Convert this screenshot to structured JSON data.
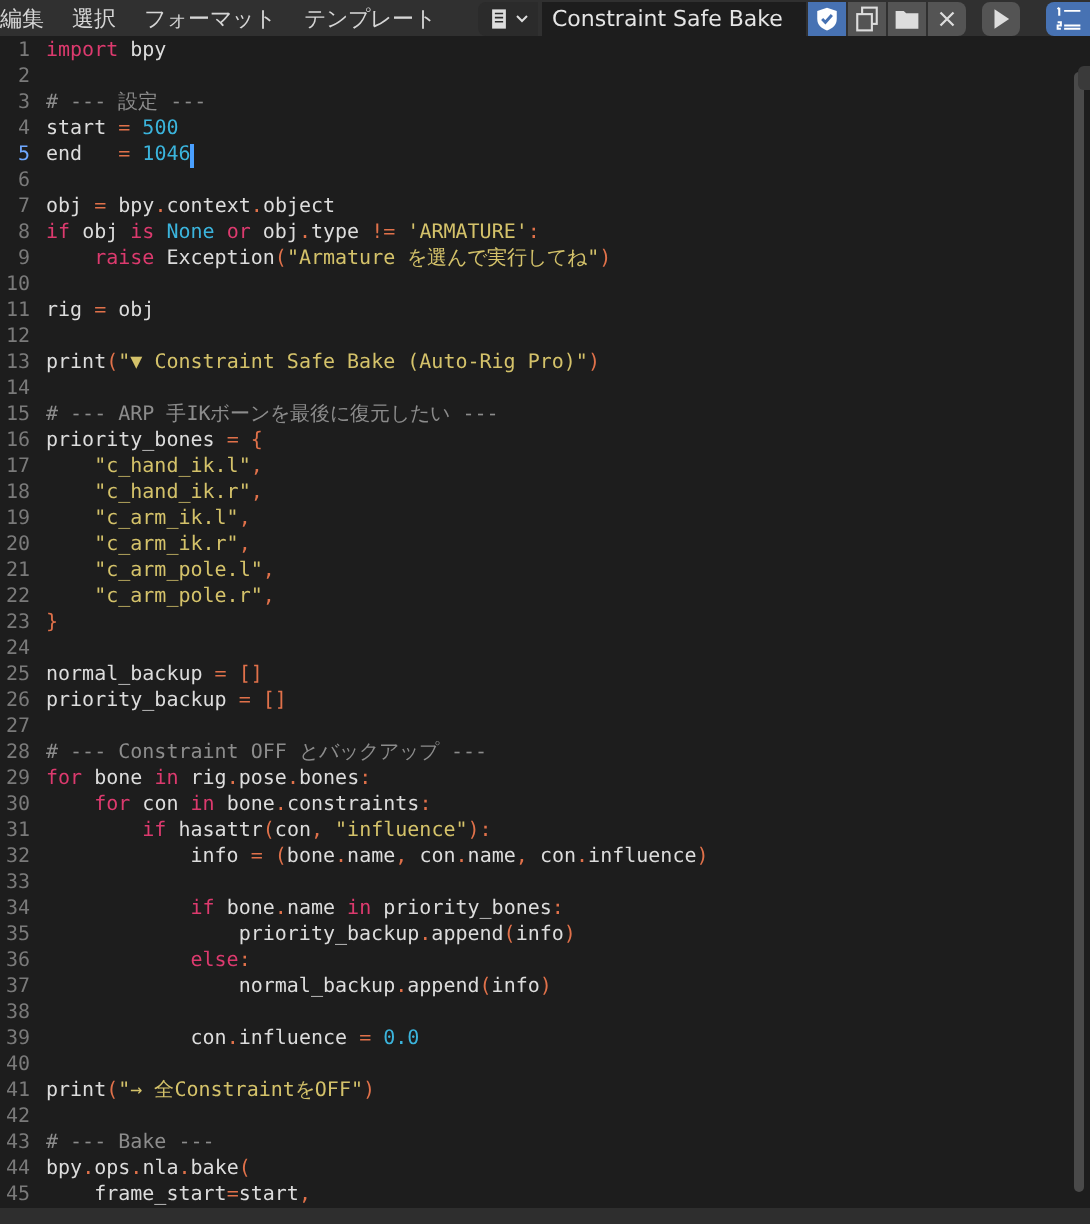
{
  "header": {
    "menus": [
      "編集",
      "選択",
      "フォーマット",
      "テンプレート"
    ],
    "text_name": "Constraint Safe Bake",
    "buttons": [
      {
        "kind": "register",
        "on": true
      },
      {
        "kind": "copy",
        "on": false
      },
      {
        "kind": "open",
        "on": false
      },
      {
        "kind": "unlink",
        "on": false
      }
    ],
    "line_numbers_toggle": {
      "on": true
    }
  },
  "editor": {
    "lines": [
      {
        "number": "1",
        "current": false,
        "tokens": [
          {
            "kind": "keyword",
            "text": "import"
          },
          {
            "kind": "plain",
            "text": " bpy"
          }
        ]
      },
      {
        "number": "2",
        "current": false
      },
      {
        "number": "3",
        "current": false,
        "tokens": [
          {
            "kind": "comment",
            "text": "# --- 設定 ---"
          }
        ]
      },
      {
        "number": "4",
        "current": false,
        "tokens": [
          {
            "kind": "plain",
            "text": "start "
          },
          {
            "kind": "op",
            "text": "="
          },
          {
            "kind": "number",
            "text": " 500"
          }
        ]
      },
      {
        "number": "5",
        "current": true,
        "tokens": [
          {
            "kind": "plain",
            "text": "end   "
          },
          {
            "kind": "op",
            "text": "="
          },
          {
            "kind": "number",
            "text": " 1046"
          }
        ]
      },
      {
        "number": "6",
        "current": false
      },
      {
        "number": "7",
        "current": false,
        "tokens": [
          {
            "kind": "plain",
            "text": "obj "
          },
          {
            "kind": "op",
            "text": "="
          },
          {
            "kind": "plain",
            "text": " bpy"
          },
          {
            "kind": "op",
            "text": "."
          },
          {
            "kind": "plain",
            "text": "context"
          },
          {
            "kind": "op",
            "text": "."
          },
          {
            "kind": "plain",
            "text": "object"
          }
        ]
      },
      {
        "number": "8",
        "current": false,
        "tokens": [
          {
            "kind": "keyword",
            "text": "if"
          },
          {
            "kind": "plain",
            "text": " obj "
          },
          {
            "kind": "keyword",
            "text": "is"
          },
          {
            "kind": "number",
            "text": " None"
          },
          {
            "kind": "keyword",
            "text": " or"
          },
          {
            "kind": "plain",
            "text": " obj"
          },
          {
            "kind": "op",
            "text": "."
          },
          {
            "kind": "plain",
            "text": "type "
          },
          {
            "kind": "op",
            "text": "!="
          },
          {
            "kind": "string",
            "text": " 'ARMATURE'"
          },
          {
            "kind": "op",
            "text": ":"
          }
        ]
      },
      {
        "number": "9",
        "current": false,
        "tokens": [
          {
            "kind": "keyword",
            "text": "    raise"
          },
          {
            "kind": "plain",
            "text": " Exception"
          },
          {
            "kind": "op",
            "text": "("
          },
          {
            "kind": "string",
            "text": "\"Armature を選んで実行してね\""
          },
          {
            "kind": "op",
            "text": ")"
          }
        ]
      },
      {
        "number": "10",
        "current": false
      },
      {
        "number": "11",
        "current": false,
        "tokens": [
          {
            "kind": "plain",
            "text": "rig "
          },
          {
            "kind": "op",
            "text": "="
          },
          {
            "kind": "plain",
            "text": " obj"
          }
        ]
      },
      {
        "number": "12",
        "current": false
      },
      {
        "number": "13",
        "current": false,
        "tokens": [
          {
            "kind": "plain",
            "text": "print"
          },
          {
            "kind": "op",
            "text": "("
          },
          {
            "kind": "string",
            "text": "\"▼ Constraint Safe Bake (Auto-Rig Pro)\""
          },
          {
            "kind": "op",
            "text": ")"
          }
        ]
      },
      {
        "number": "14",
        "current": false
      },
      {
        "number": "15",
        "current": false,
        "tokens": [
          {
            "kind": "comment",
            "text": "# --- ARP 手IKボーンを最後に復元したい ---"
          }
        ]
      },
      {
        "number": "16",
        "current": false,
        "tokens": [
          {
            "kind": "plain",
            "text": "priority_bones "
          },
          {
            "kind": "op",
            "text": "= {"
          }
        ]
      },
      {
        "number": "17",
        "current": false,
        "tokens": [
          {
            "kind": "string",
            "text": "    \"c_hand_ik.l\""
          },
          {
            "kind": "op",
            "text": ","
          }
        ]
      },
      {
        "number": "18",
        "current": false,
        "tokens": [
          {
            "kind": "string",
            "text": "    \"c_hand_ik.r\""
          },
          {
            "kind": "op",
            "text": ","
          }
        ]
      },
      {
        "number": "19",
        "current": false,
        "tokens": [
          {
            "kind": "string",
            "text": "    \"c_arm_ik.l\""
          },
          {
            "kind": "op",
            "text": ","
          }
        ]
      },
      {
        "number": "20",
        "current": false,
        "tokens": [
          {
            "kind": "string",
            "text": "    \"c_arm_ik.r\""
          },
          {
            "kind": "op",
            "text": ","
          }
        ]
      },
      {
        "number": "21",
        "current": false,
        "tokens": [
          {
            "kind": "string",
            "text": "    \"c_arm_pole.l\""
          },
          {
            "kind": "op",
            "text": ","
          }
        ]
      },
      {
        "number": "22",
        "current": false,
        "tokens": [
          {
            "kind": "string",
            "text": "    \"c_arm_pole.r\""
          },
          {
            "kind": "op",
            "text": ","
          }
        ]
      },
      {
        "number": "23",
        "current": false,
        "tokens": [
          {
            "kind": "op",
            "text": "}"
          }
        ]
      },
      {
        "number": "24",
        "current": false
      },
      {
        "number": "25",
        "current": false,
        "tokens": [
          {
            "kind": "plain",
            "text": "normal_backup "
          },
          {
            "kind": "op",
            "text": "= []"
          }
        ]
      },
      {
        "number": "26",
        "current": false,
        "tokens": [
          {
            "kind": "plain",
            "text": "priority_backup "
          },
          {
            "kind": "op",
            "text": "= []"
          }
        ]
      },
      {
        "number": "27",
        "current": false
      },
      {
        "number": "28",
        "current": false,
        "tokens": [
          {
            "kind": "comment",
            "text": "# --- Constraint OFF とバックアップ ---"
          }
        ]
      },
      {
        "number": "29",
        "current": false,
        "tokens": [
          {
            "kind": "keyword",
            "text": "for"
          },
          {
            "kind": "plain",
            "text": " bone "
          },
          {
            "kind": "keyword",
            "text": "in"
          },
          {
            "kind": "plain",
            "text": " rig"
          },
          {
            "kind": "op",
            "text": "."
          },
          {
            "kind": "plain",
            "text": "pose"
          },
          {
            "kind": "op",
            "text": "."
          },
          {
            "kind": "plain",
            "text": "bones"
          },
          {
            "kind": "op",
            "text": ":"
          }
        ]
      },
      {
        "number": "30",
        "current": false,
        "tokens": [
          {
            "kind": "keyword",
            "text": "    for"
          },
          {
            "kind": "plain",
            "text": " con "
          },
          {
            "kind": "keyword",
            "text": "in"
          },
          {
            "kind": "plain",
            "text": " bone"
          },
          {
            "kind": "op",
            "text": "."
          },
          {
            "kind": "plain",
            "text": "constraints"
          },
          {
            "kind": "op",
            "text": ":"
          }
        ]
      },
      {
        "number": "31",
        "current": false,
        "tokens": [
          {
            "kind": "keyword",
            "text": "        if"
          },
          {
            "kind": "plain",
            "text": " hasattr"
          },
          {
            "kind": "op",
            "text": "("
          },
          {
            "kind": "plain",
            "text": "con"
          },
          {
            "kind": "op",
            "text": ","
          },
          {
            "kind": "string",
            "text": " \"influence\""
          },
          {
            "kind": "op",
            "text": "):"
          }
        ]
      },
      {
        "number": "32",
        "current": false,
        "tokens": [
          {
            "kind": "plain",
            "text": "            info "
          },
          {
            "kind": "op",
            "text": "= ("
          },
          {
            "kind": "plain",
            "text": "bone"
          },
          {
            "kind": "op",
            "text": "."
          },
          {
            "kind": "plain",
            "text": "name"
          },
          {
            "kind": "op",
            "text": ","
          },
          {
            "kind": "plain",
            "text": " con"
          },
          {
            "kind": "op",
            "text": "."
          },
          {
            "kind": "plain",
            "text": "name"
          },
          {
            "kind": "op",
            "text": ","
          },
          {
            "kind": "plain",
            "text": " con"
          },
          {
            "kind": "op",
            "text": "."
          },
          {
            "kind": "plain",
            "text": "influence"
          },
          {
            "kind": "op",
            "text": ")"
          }
        ]
      },
      {
        "number": "33",
        "current": false
      },
      {
        "number": "34",
        "current": false,
        "tokens": [
          {
            "kind": "keyword",
            "text": "            if"
          },
          {
            "kind": "plain",
            "text": " bone"
          },
          {
            "kind": "op",
            "text": "."
          },
          {
            "kind": "plain",
            "text": "name "
          },
          {
            "kind": "keyword",
            "text": "in"
          },
          {
            "kind": "plain",
            "text": " priority_bones"
          },
          {
            "kind": "op",
            "text": ":"
          }
        ]
      },
      {
        "number": "35",
        "current": false,
        "tokens": [
          {
            "kind": "plain",
            "text": "                priority_backup"
          },
          {
            "kind": "op",
            "text": "."
          },
          {
            "kind": "plain",
            "text": "append"
          },
          {
            "kind": "op",
            "text": "("
          },
          {
            "kind": "plain",
            "text": "info"
          },
          {
            "kind": "op",
            "text": ")"
          }
        ]
      },
      {
        "number": "36",
        "current": false,
        "tokens": [
          {
            "kind": "keyword",
            "text": "            else"
          },
          {
            "kind": "op",
            "text": ":"
          }
        ]
      },
      {
        "number": "37",
        "current": false,
        "tokens": [
          {
            "kind": "plain",
            "text": "                normal_backup"
          },
          {
            "kind": "op",
            "text": "."
          },
          {
            "kind": "plain",
            "text": "append"
          },
          {
            "kind": "op",
            "text": "("
          },
          {
            "kind": "plain",
            "text": "info"
          },
          {
            "kind": "op",
            "text": ")"
          }
        ]
      },
      {
        "number": "38",
        "current": false
      },
      {
        "number": "39",
        "current": false,
        "tokens": [
          {
            "kind": "plain",
            "text": "            con"
          },
          {
            "kind": "op",
            "text": "."
          },
          {
            "kind": "plain",
            "text": "influence "
          },
          {
            "kind": "op",
            "text": "="
          },
          {
            "kind": "number",
            "text": " 0.0"
          }
        ]
      },
      {
        "number": "40",
        "current": false
      },
      {
        "number": "41",
        "current": false,
        "tokens": [
          {
            "kind": "plain",
            "text": "print"
          },
          {
            "kind": "op",
            "text": "("
          },
          {
            "kind": "string",
            "text": "\"→ 全ConstraintをOFF\""
          },
          {
            "kind": "op",
            "text": ")"
          }
        ]
      },
      {
        "number": "42",
        "current": false
      },
      {
        "number": "43",
        "current": false,
        "tokens": [
          {
            "kind": "comment",
            "text": "# --- Bake ---"
          }
        ]
      },
      {
        "number": "44",
        "current": false,
        "tokens": [
          {
            "kind": "plain",
            "text": "bpy"
          },
          {
            "kind": "op",
            "text": "."
          },
          {
            "kind": "plain",
            "text": "ops"
          },
          {
            "kind": "op",
            "text": "."
          },
          {
            "kind": "plain",
            "text": "nla"
          },
          {
            "kind": "op",
            "text": "."
          },
          {
            "kind": "plain",
            "text": "bake"
          },
          {
            "kind": "op",
            "text": "("
          }
        ]
      },
      {
        "number": "45",
        "current": false,
        "tokens": [
          {
            "kind": "plain",
            "text": "    frame_start"
          },
          {
            "kind": "op",
            "text": "="
          },
          {
            "kind": "plain",
            "text": "start"
          },
          {
            "kind": "op",
            "text": ","
          }
        ]
      }
    ]
  }
}
